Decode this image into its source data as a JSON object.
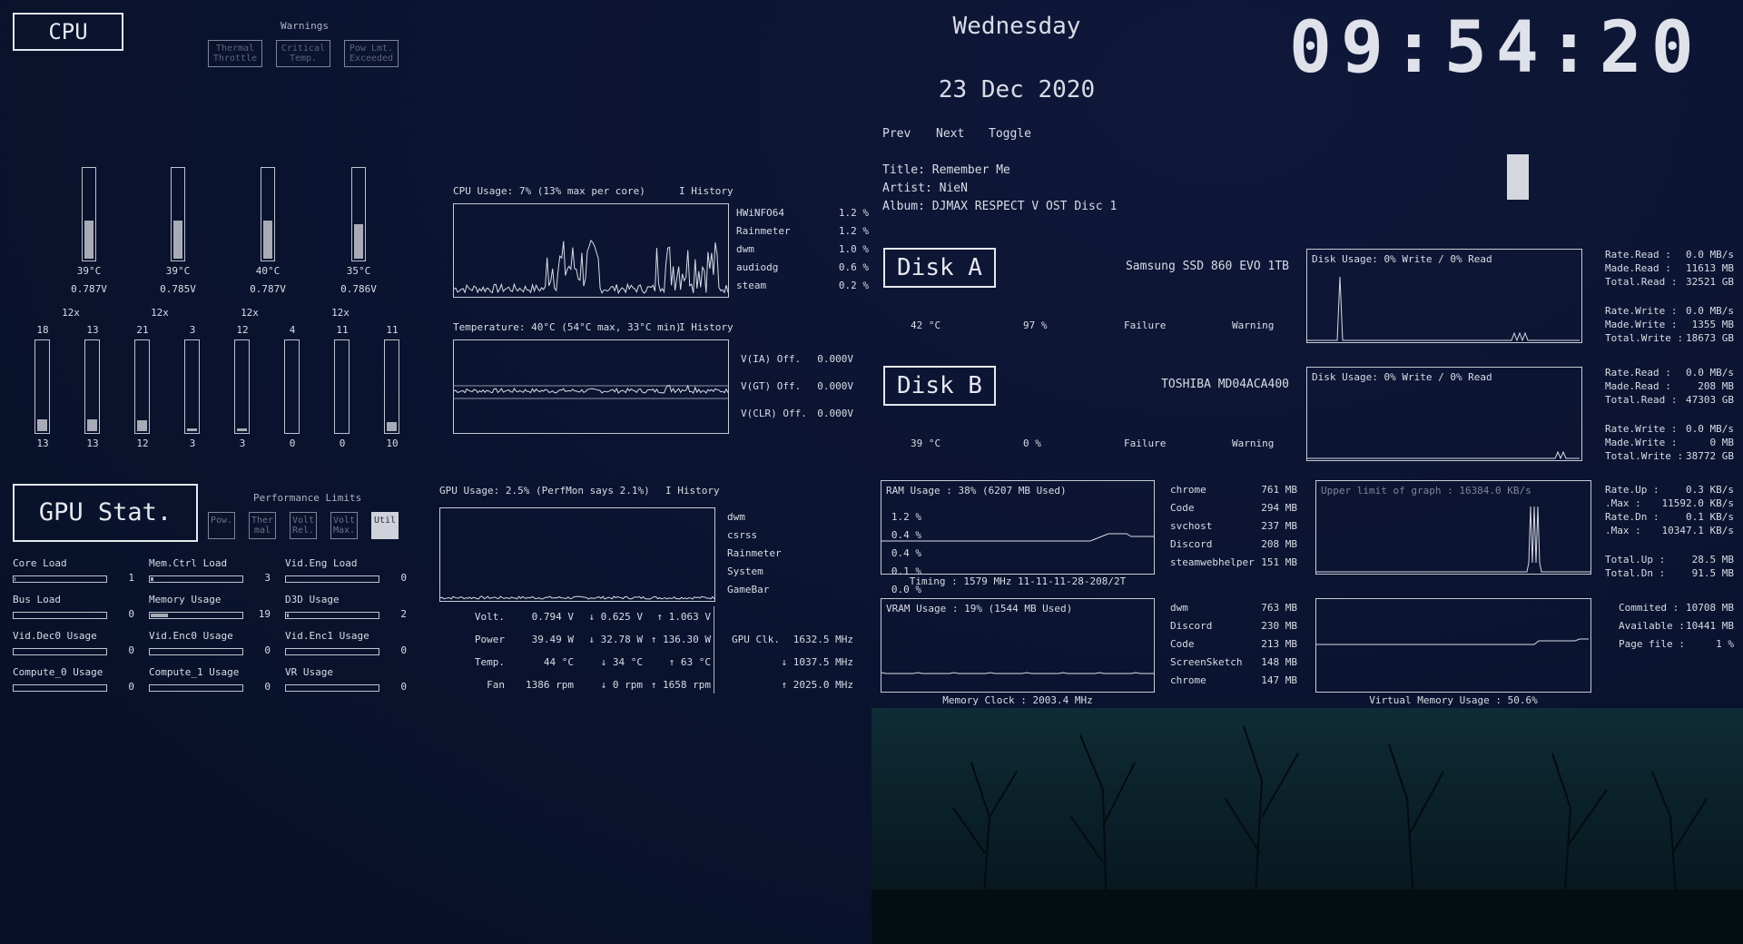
{
  "cpu": {
    "title": "CPU",
    "warnings_label": "Warnings",
    "warnings": [
      {
        "line1": "Thermal",
        "line2": "Throttle"
      },
      {
        "line1": "Critical",
        "line2": "Temp."
      },
      {
        "line1": "Pow Lmt.",
        "line2": "Exceeded"
      }
    ],
    "cores": [
      {
        "temp": "39°C",
        "volt": "0.787V",
        "level": 0.42
      },
      {
        "temp": "39°C",
        "volt": "0.785V",
        "level": 0.42
      },
      {
        "temp": "40°C",
        "volt": "0.787V",
        "level": 0.42
      },
      {
        "temp": "35°C",
        "volt": "0.786V",
        "level": 0.38
      }
    ],
    "multipliers": [
      "12x",
      "12x",
      "12x",
      "12x"
    ],
    "threads": [
      {
        "top": "18",
        "bottom": "13",
        "level": 0.13
      },
      {
        "top": "13",
        "bottom": "13",
        "level": 0.13
      },
      {
        "top": "21",
        "bottom": "12",
        "level": 0.12
      },
      {
        "top": "3",
        "bottom": "3",
        "level": 0.03
      },
      {
        "top": "12",
        "bottom": "3",
        "level": 0.03
      },
      {
        "top": "4",
        "bottom": "0",
        "level": 0.0
      },
      {
        "top": "11",
        "bottom": "0",
        "level": 0.0
      },
      {
        "top": "11",
        "bottom": "10",
        "level": 0.1
      }
    ],
    "usage_title": "CPU Usage: 7% (13% max per core)",
    "history_label": "I History",
    "processes": [
      {
        "name": "HWiNFO64",
        "value": "1.2 %"
      },
      {
        "name": "Rainmeter",
        "value": "1.2 %"
      },
      {
        "name": "dwm",
        "value": "1.0 %"
      },
      {
        "name": "audiodg",
        "value": "0.6 %"
      },
      {
        "name": "steam",
        "value": "0.2 %"
      }
    ],
    "temp_title": "Temperature: 40°C (54°C max, 33°C min)",
    "temp_history_label": "I History",
    "volt_offsets": [
      {
        "name": "V(IA) Off.",
        "value": "0.000V"
      },
      {
        "name": "V(GT) Off.",
        "value": "0.000V"
      },
      {
        "name": "V(CLR) Off.",
        "value": "0.000V"
      }
    ]
  },
  "gpu": {
    "title": "GPU Stat.",
    "perf_limits_label": "Performance Limits",
    "perf_limits": [
      {
        "line1": "Pow.",
        "line2": "",
        "active": false
      },
      {
        "line1": "Ther",
        "line2": "mal",
        "active": false
      },
      {
        "line1": "Volt",
        "line2": "Rel.",
        "active": false
      },
      {
        "line1": "Volt",
        "line2": "Max.",
        "active": false
      },
      {
        "line1": "Util",
        "line2": "",
        "active": true
      }
    ],
    "loads": [
      {
        "label": "Core Load",
        "value": "1",
        "level": 0.01
      },
      {
        "label": "Mem.Ctrl Load",
        "value": "3",
        "level": 0.03
      },
      {
        "label": "Vid.Eng Load",
        "value": "0",
        "level": 0.0
      },
      {
        "label": "Bus Load",
        "value": "0",
        "level": 0.0
      },
      {
        "label": "Memory Usage",
        "value": "19",
        "level": 0.19
      },
      {
        "label": "D3D Usage",
        "value": "2",
        "level": 0.02
      },
      {
        "label": "Vid.Dec0 Usage",
        "value": "0",
        "level": 0.0
      },
      {
        "label": "Vid.Enc0 Usage",
        "value": "0",
        "level": 0.0
      },
      {
        "label": "Vid.Enc1 Usage",
        "value": "0",
        "level": 0.0
      },
      {
        "label": "Compute_0 Usage",
        "value": "0",
        "level": 0.0
      },
      {
        "label": "Compute_1 Usage",
        "value": "0",
        "level": 0.0
      },
      {
        "label": "VR Usage",
        "value": "0",
        "level": 0.0
      }
    ],
    "usage_title": "GPU Usage: 2.5% (PerfMon says 2.1%)",
    "history_label": "I History",
    "processes": [
      {
        "name": "dwm",
        "value": "1.2 %"
      },
      {
        "name": "csrss",
        "value": "0.4 %"
      },
      {
        "name": "Rainmeter",
        "value": "0.4 %"
      },
      {
        "name": "System",
        "value": "0.1 %"
      },
      {
        "name": "GameBar",
        "value": "0.0 %"
      }
    ],
    "stats": [
      {
        "label": "Volt.",
        "cur": "0.794 V",
        "min": "↓ 0.625 V",
        "max": "↑ 1.063 V"
      },
      {
        "label": "Power",
        "cur": "39.49 W",
        "min": "↓ 32.78 W",
        "max": "↑ 136.30 W"
      },
      {
        "label": "Temp.",
        "cur": "44 °C",
        "min": "↓ 34 °C",
        "max": "↑ 63 °C"
      },
      {
        "label": "Fan",
        "cur": "1386 rpm",
        "min": "↓ 0 rpm",
        "max": "↑ 1658 rpm"
      }
    ],
    "clock_label": "GPU Clk.",
    "clock_cur": "1632.5 MHz",
    "clock_min": "↓ 1037.5 MHz",
    "clock_max": "↑ 2025.0 MHz"
  },
  "datetime": {
    "day": "Wednesday",
    "date": "23 Dec 2020",
    "time": "09:54:20"
  },
  "media": {
    "prev": "Prev",
    "next": "Next",
    "toggle": "Toggle",
    "title": "Title: Remember Me",
    "artist": "Artist: NieN",
    "album": "Album: DJMAX RESPECT V OST Disc 1"
  },
  "disks": [
    {
      "title": "Disk A",
      "model": "Samsung SSD 860 EVO 1TB",
      "temp": "42 °C",
      "health": "97 %",
      "failure": "Failure",
      "warning": "Warning",
      "graph_title": "Disk Usage: 0% Write / 0% Read",
      "stats": [
        {
          "label": "Rate.Read :",
          "value": "0.0 MB/s"
        },
        {
          "label": "Made.Read :",
          "value": "11613 MB"
        },
        {
          "label": "Total.Read :",
          "value": "32521 GB"
        },
        {
          "label": "Rate.Write :",
          "value": "0.0 MB/s"
        },
        {
          "label": "Made.Write :",
          "value": "1355 MB"
        },
        {
          "label": "Total.Write :",
          "value": "18673 GB"
        }
      ]
    },
    {
      "title": "Disk B",
      "model": "TOSHIBA MD04ACA400",
      "temp": "39 °C",
      "health": "0 %",
      "failure": "Failure",
      "warning": "Warning",
      "graph_title": "Disk Usage: 0% Write / 0% Read",
      "stats": [
        {
          "label": "Rate.Read :",
          "value": "0.0 MB/s"
        },
        {
          "label": "Made.Read :",
          "value": "208 MB"
        },
        {
          "label": "Total.Read :",
          "value": "47303 GB"
        },
        {
          "label": "Rate.Write :",
          "value": "0.0 MB/s"
        },
        {
          "label": "Made.Write :",
          "value": "0 MB"
        },
        {
          "label": "Total.Write :",
          "value": "38772 GB"
        }
      ]
    }
  ],
  "ram": {
    "title": "RAM Usage : 38% (6207 MB Used)",
    "timing": "Timing : 1579 MHz 11-11-11-28-208/2T",
    "processes": [
      {
        "name": "chrome",
        "value": "761 MB"
      },
      {
        "name": "Code",
        "value": "294 MB"
      },
      {
        "name": "svchost",
        "value": "237 MB"
      },
      {
        "name": "Discord",
        "value": "208 MB"
      },
      {
        "name": "steamwebhelper",
        "value": "151 MB"
      }
    ]
  },
  "vram": {
    "title": "VRAM Usage : 19% (1544 MB Used)",
    "clock": "Memory Clock : 2003.4 MHz",
    "processes": [
      {
        "name": "dwm",
        "value": "763 MB"
      },
      {
        "name": "Discord",
        "value": "230 MB"
      },
      {
        "name": "Code",
        "value": "213 MB"
      },
      {
        "name": "ScreenSketch",
        "value": "148 MB"
      },
      {
        "name": "chrome",
        "value": "147 MB"
      }
    ]
  },
  "network": {
    "graph_title": "Upper limit of graph : 16384.0 KB/s",
    "stats": [
      {
        "label": "Rate.Up :",
        "value": "0.3 KB/s"
      },
      {
        "label": ".Max :",
        "value": "11592.0 KB/s"
      },
      {
        "label": "Rate.Dn :",
        "value": "0.1 KB/s"
      },
      {
        "label": ".Max :",
        "value": "10347.1 KB/s"
      },
      {
        "label": "Total.Up :",
        "value": "28.5 MB"
      },
      {
        "label": "Total.Dn :",
        "value": "91.5 MB"
      }
    ]
  },
  "virtual_memory": {
    "title": "Virtual Memory Usage : 50.6%",
    "stats": [
      {
        "label": "Commited :",
        "value": "10708 MB"
      },
      {
        "label": "Available :",
        "value": "10441 MB"
      },
      {
        "label": "Page file :",
        "value": "1 %"
      }
    ]
  },
  "colors": {
    "background": "#0b1431",
    "text": "#d9dce6",
    "accent": "#e6e8ef"
  }
}
